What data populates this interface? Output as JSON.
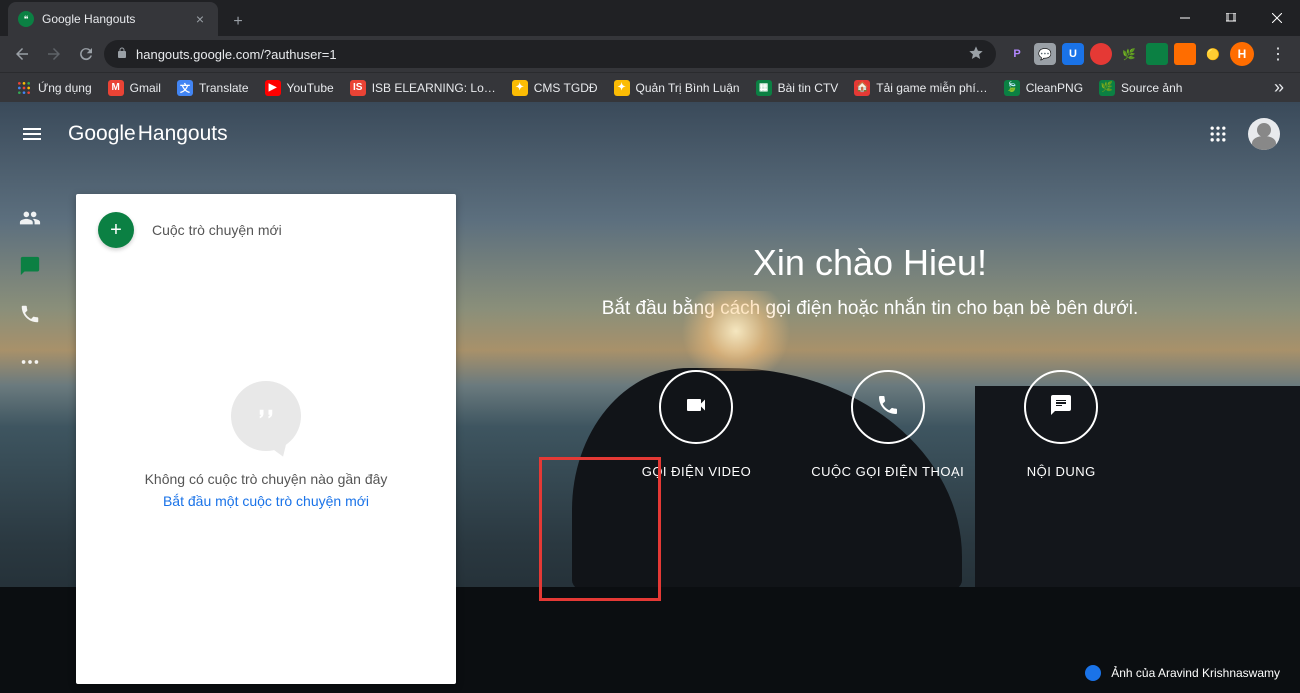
{
  "tab": {
    "title": "Google Hangouts"
  },
  "url": "hangouts.google.com/?authuser=1",
  "profile_letter": "H",
  "ext_letters": [
    "P"
  ],
  "bookmarks": [
    {
      "label": "Ứng dụng"
    },
    {
      "label": "Gmail"
    },
    {
      "label": "Translate"
    },
    {
      "label": "YouTube"
    },
    {
      "label": "ISB ELEARNING: Lo…"
    },
    {
      "label": "CMS TGDĐ"
    },
    {
      "label": "Quản Trị Bình Luận"
    },
    {
      "label": "Bài tin CTV"
    },
    {
      "label": "Tải game miễn phí…"
    },
    {
      "label": "CleanPNG"
    },
    {
      "label": "Source ảnh"
    }
  ],
  "app": {
    "logo_google": "Google",
    "logo_hangouts": "Hangouts"
  },
  "chat_panel": {
    "new_conversation": "Cuộc trò chuyện mới",
    "empty_message": "Không có cuộc trò chuyện nào gần đây",
    "start_link": "Bắt đầu một cuộc trò chuyện mới"
  },
  "hero": {
    "greeting": "Xin chào Hieu!",
    "subtitle": "Bắt đầu bằng cách gọi điện hoặc nhắn tin cho bạn bè bên dưới."
  },
  "actions": {
    "video": "GỌI ĐIỆN VIDEO",
    "phone": "CUỘC GỌI ĐIỆN THOẠI",
    "message": "NỘI DUNG"
  },
  "credit": "Ảnh của Aravind Krishnaswamy"
}
